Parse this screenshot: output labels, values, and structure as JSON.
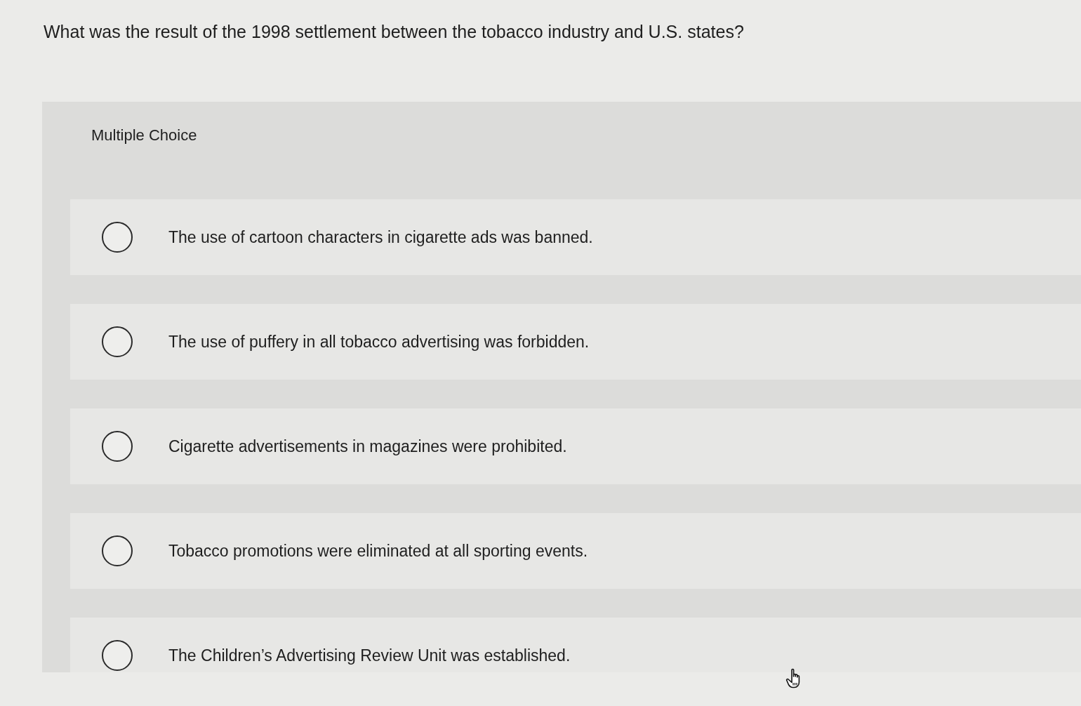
{
  "question": "What was the result of the 1998 settlement between the tobacco industry and U.S. states?",
  "answer_panel": {
    "heading": "Multiple Choice",
    "options": [
      {
        "text": "The use of cartoon characters in cigarette ads was banned.",
        "selected": false
      },
      {
        "text": "The use of puffery in all tobacco advertising was forbidden.",
        "selected": false
      },
      {
        "text": "Cigarette advertisements in magazines were prohibited.",
        "selected": false
      },
      {
        "text": "Tobacco promotions were eliminated at all sporting events.",
        "selected": false
      },
      {
        "text": "The Children’s Advertising Review Unit was established.",
        "selected": false
      }
    ]
  }
}
